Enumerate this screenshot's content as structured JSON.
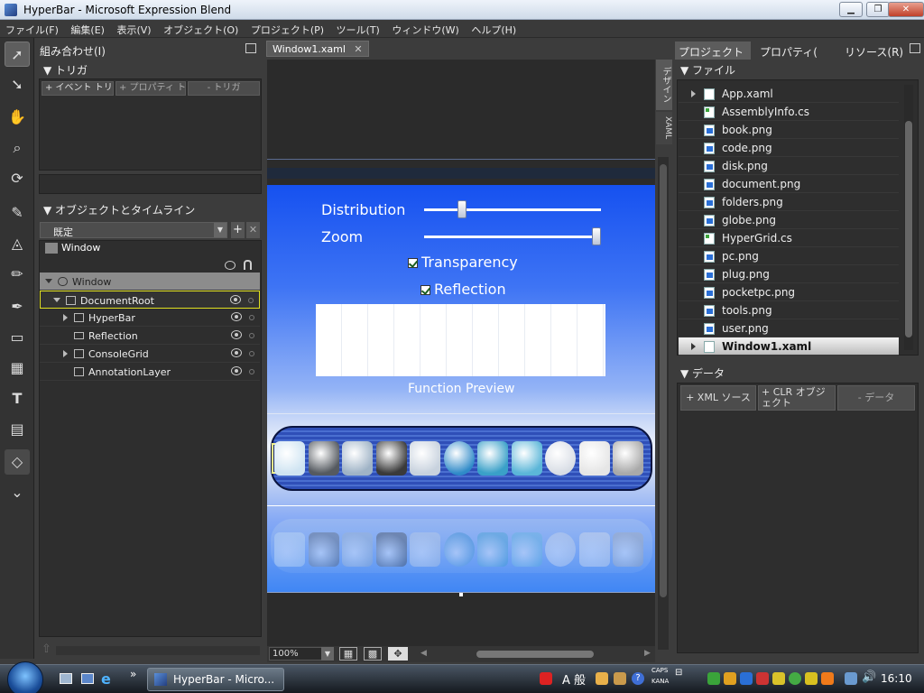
{
  "window": {
    "title": "HyperBar - Microsoft Expression Blend"
  },
  "menu": [
    "ファイル(F)",
    "編集(E)",
    "表示(V)",
    "オブジェクト(O)",
    "プロジェクト(P)",
    "ツール(T)",
    "ウィンドウ(W)",
    "ヘルプ(H)"
  ],
  "interaction": {
    "header": "組み合わせ(I)",
    "triggers_title": "▼ トリガ",
    "trigger_buttons": [
      "+ イベント トリ",
      "+ プロパティ ト",
      "- トリガ"
    ],
    "objects_title": "▼ オブジェクトとタイムライン",
    "timeline_combo": "既定",
    "scope_label": "Window",
    "tree": [
      {
        "label": "Window"
      },
      {
        "label": "DocumentRoot"
      },
      {
        "label": "HyperBar"
      },
      {
        "label": "Reflection"
      },
      {
        "label": "ConsoleGrid"
      },
      {
        "label": "AnnotationLayer"
      }
    ]
  },
  "document": {
    "tab_label": "Window1.xaml",
    "view_tabs": [
      "デザイン",
      "XAML"
    ],
    "zoom": "100%"
  },
  "stage": {
    "distribution_label": "Distribution",
    "zoom_label": "Zoom",
    "distribution_value": 0.2,
    "zoom_value": 1.0,
    "transparency_label": "Transparency",
    "reflection_label": "Reflection",
    "transparency_checked": true,
    "reflection_checked": true,
    "preview_caption": "Function Preview",
    "hyperbar_icons": [
      "footprint-icon",
      "drill-icon",
      "pda-icon",
      "plug-icon",
      "laptop-icon",
      "globe-icon",
      "book-icon",
      "pocketpc-icon",
      "disc-icon",
      "magnifier-icon",
      "server-icon"
    ]
  },
  "right": {
    "tabs": [
      "プロジェクト",
      "プロパティ(",
      "リソース(R)"
    ],
    "files_title": "▼ ファイル",
    "files": [
      {
        "name": "App.xaml",
        "kind": "xaml"
      },
      {
        "name": "AssemblyInfo.cs",
        "kind": "cs"
      },
      {
        "name": "book.png",
        "kind": "png"
      },
      {
        "name": "code.png",
        "kind": "png"
      },
      {
        "name": "disk.png",
        "kind": "png"
      },
      {
        "name": "document.png",
        "kind": "png"
      },
      {
        "name": "folders.png",
        "kind": "png"
      },
      {
        "name": "globe.png",
        "kind": "png"
      },
      {
        "name": "HyperGrid.cs",
        "kind": "cs"
      },
      {
        "name": "pc.png",
        "kind": "png"
      },
      {
        "name": "plug.png",
        "kind": "png"
      },
      {
        "name": "pocketpc.png",
        "kind": "png"
      },
      {
        "name": "tools.png",
        "kind": "png"
      },
      {
        "name": "user.png",
        "kind": "png"
      },
      {
        "name": "Window1.xaml",
        "kind": "xaml"
      }
    ],
    "data_title": "▼ データ",
    "data_buttons": [
      "+ XML ソース",
      "+ CLR オブジェクト",
      "- データ"
    ]
  },
  "taskbar": {
    "task_label": "HyperBar - Micro...",
    "ime_label": "A 般",
    "caps": "CAPS",
    "kana": "KANA",
    "clock": "16:10"
  },
  "colors": {
    "accent": "#1651f0",
    "selection": "#e0e020"
  }
}
